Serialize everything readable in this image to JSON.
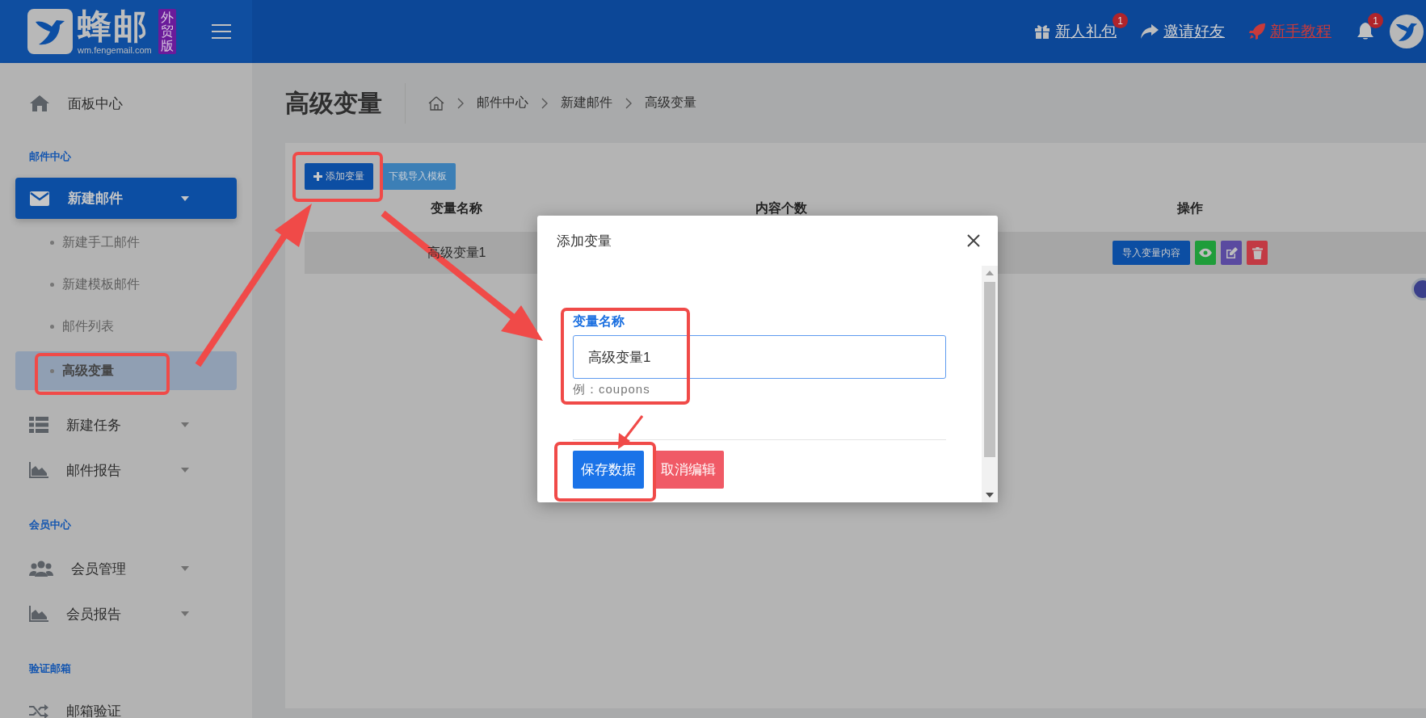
{
  "header": {
    "logo": {
      "name": "蜂邮",
      "domain": "wm.fengemail.com",
      "badge": "外贸版"
    },
    "links": [
      {
        "kind": "gift",
        "label": "新人礼包",
        "badge": "1"
      },
      {
        "kind": "share",
        "label": "邀请好友"
      },
      {
        "kind": "rocket",
        "label": "新手教程"
      }
    ],
    "notifications": {
      "badge": "1"
    }
  },
  "sidebar": {
    "items": [
      {
        "kind": "link",
        "label": "面板中心"
      },
      {
        "kind": "section",
        "label": "邮件中心"
      },
      {
        "kind": "menu",
        "label": "新建邮件",
        "selected": true,
        "children": [
          {
            "label": "新建手工邮件",
            "selected": false
          },
          {
            "label": "新建模板邮件",
            "selected": false
          },
          {
            "label": "邮件列表",
            "selected": false
          },
          {
            "label": "高级变量",
            "selected": true
          }
        ]
      },
      {
        "kind": "menu",
        "label": "新建任务",
        "selected": false
      },
      {
        "kind": "menu",
        "label": "邮件报告",
        "selected": false
      },
      {
        "kind": "section",
        "label": "会员中心"
      },
      {
        "kind": "menu",
        "label": "会员管理",
        "selected": false
      },
      {
        "kind": "menu",
        "label": "会员报告",
        "selected": false
      },
      {
        "kind": "section",
        "label": "验证邮箱"
      },
      {
        "kind": "link",
        "label": "邮箱验证"
      }
    ]
  },
  "page": {
    "title": "高级变量",
    "breadcrumb": [
      "邮件中心",
      "新建邮件",
      "高级变量"
    ]
  },
  "toolbar": [
    {
      "kind": "add",
      "label": "添加变量"
    },
    {
      "kind": "download",
      "label": "下载导入模板"
    }
  ],
  "table": {
    "columns": [
      "变量名称",
      "内容个数",
      "操作"
    ],
    "rows": [
      {
        "name": "高级变量1",
        "actions": [
          {
            "kind": "import",
            "label": "导入变量内容"
          },
          {
            "kind": "view"
          },
          {
            "kind": "edit"
          },
          {
            "kind": "delete"
          }
        ]
      }
    ]
  },
  "modal": {
    "title": "添加变量",
    "field": {
      "label": "变量名称",
      "value": "高级变量1",
      "hint": "例：coupons"
    },
    "buttons": [
      {
        "kind": "primary",
        "label": "保存数据"
      },
      {
        "kind": "danger",
        "label": "取消编辑"
      }
    ]
  }
}
